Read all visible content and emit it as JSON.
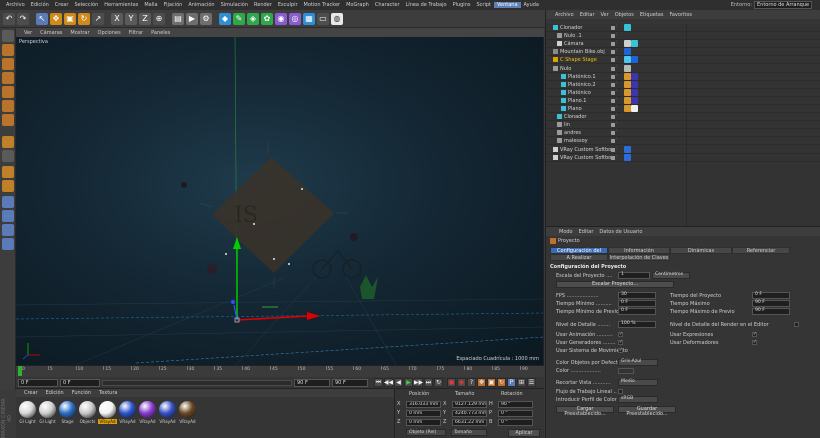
{
  "menubar": {
    "items": [
      "Archivo",
      "Edición",
      "Crear",
      "Selección",
      "Herramientas",
      "Malla",
      "Fijación",
      "Animación",
      "Simulación",
      "Render",
      "Esculpir",
      "Motion Tracker",
      "MoGraph",
      "Character",
      "Línea de Trabajo",
      "Plugins",
      "Script",
      "Ventana",
      "Ayuda"
    ],
    "active_index": 17,
    "entorno_label": "Entorno:",
    "entorno_value": "Entorno de Arranque"
  },
  "viewport": {
    "menu": [
      "Ver",
      "Cámaras",
      "Mostrar",
      "Opciones",
      "Filtrar",
      "Paneles"
    ],
    "view_name": "Perspectiva",
    "grid_info": "Espaciado Cuadrícula : 1000 mm",
    "colors": {
      "bg_center": "#1f3b4c",
      "bg_edge": "#0b1820",
      "axis_y": "#00c000",
      "axis_x": "#e00000",
      "axis_z": "#3050ff"
    }
  },
  "timeline": {
    "ticks": [
      "0",
      "5",
      "10",
      "15",
      "20",
      "25",
      "30",
      "35",
      "40",
      "45",
      "50",
      "55",
      "60",
      "65",
      "70",
      "75",
      "80",
      "85",
      "90"
    ],
    "current_frame": "0 F",
    "start_frame": "0 F",
    "end_frame_a": "90 F",
    "end_frame_b": "90 F"
  },
  "materials": {
    "menu": [
      "Crear",
      "Edición",
      "Función",
      "Textura"
    ],
    "items": [
      {
        "name": "Gl Light",
        "color": "#d8d8d8"
      },
      {
        "name": "Gl Light",
        "color": "#cfcfcf"
      },
      {
        "name": "Stage",
        "color": "#2a6fc9"
      },
      {
        "name": "Objects",
        "color": "#c8c8c8"
      },
      {
        "name": "VRayAd",
        "color": "#f3f3f3",
        "selected": true
      },
      {
        "name": "VRayAd",
        "color": "#2a55d0"
      },
      {
        "name": "VRayAd",
        "color": "#8a3bd0"
      },
      {
        "name": "VRayAd",
        "color": "#3550c8"
      },
      {
        "name": "VRayAd",
        "color": "#6a4a25"
      }
    ]
  },
  "coordinates": {
    "headers": [
      "Posición",
      "Tamaño",
      "Rotación"
    ],
    "rows": [
      {
        "axis": "X",
        "pos": "316.033 mm",
        "size_axis": "X",
        "size": "9127.129 mm",
        "rot_axis": "H",
        "rot": "90 °"
      },
      {
        "axis": "Y",
        "pos": "0 mm",
        "size_axis": "Y",
        "size": "4240.773 mm",
        "rot_axis": "P",
        "rot": "0 °"
      },
      {
        "axis": "Z",
        "pos": "0 mm",
        "size_axis": "Z",
        "size": "6631.22 mm",
        "rot_axis": "B",
        "rot": "0 °"
      }
    ],
    "mode": "Objeto (Rel)",
    "size_mode": "Tamaño",
    "apply": "Aplicar"
  },
  "object_manager": {
    "tabs": [
      "Archivo",
      "Editar",
      "Ver",
      "Objetos",
      "Etiquetas",
      "Favoritos"
    ],
    "rows": [
      {
        "name": "Clonador",
        "indent": 0,
        "icon": "#39c1d8",
        "tags": [
          "#39c1d8"
        ]
      },
      {
        "name": "Nulo .1",
        "indent": 1,
        "icon": "#9a9a9a",
        "tags": []
      },
      {
        "name": "Cámara",
        "indent": 1,
        "icon": "#d0d0d0",
        "tags": [
          "#d0d0d0",
          "#39c1d8"
        ]
      },
      {
        "name": "Mountain Bike.obj",
        "indent": 0,
        "icon": "#8a8a8a",
        "tags": [
          "#1c64d8"
        ]
      },
      {
        "name": "C Shape Stage",
        "indent": 0,
        "icon": "#e0a100",
        "tags": [
          "#4dc6f0",
          "#1c64d8"
        ],
        "selected": true
      },
      {
        "name": "Nulo",
        "indent": 0,
        "icon": "#9a9a9a",
        "tags": [
          "#b9b9b9"
        ]
      },
      {
        "name": "Platónico.1",
        "indent": 2,
        "icon": "#39c1d8",
        "tags": [
          "#d79a2a",
          "#3d35b0"
        ]
      },
      {
        "name": "Platónico.2",
        "indent": 2,
        "icon": "#39c1d8",
        "tags": [
          "#d79a2a",
          "#3d35b0"
        ]
      },
      {
        "name": "Platónico",
        "indent": 2,
        "icon": "#39c1d8",
        "tags": [
          "#d79a2a",
          "#3d35b0"
        ]
      },
      {
        "name": "Plano.1",
        "indent": 2,
        "icon": "#39c1d8",
        "tags": [
          "#d79a2a",
          "#3d35b0"
        ]
      },
      {
        "name": "Plano",
        "indent": 2,
        "icon": "#39c1d8",
        "tags": [
          "#d79a2a",
          "#f0f0f0"
        ]
      },
      {
        "name": "Clonador",
        "indent": 1,
        "icon": "#39c1d8",
        "tags": []
      },
      {
        "name": "lin",
        "indent": 1,
        "icon": "#9a9a9a",
        "tags": []
      },
      {
        "name": "andres",
        "indent": 1,
        "icon": "#9a9a9a",
        "tags": []
      },
      {
        "name": "malessoy",
        "indent": 1,
        "icon": "#9a9a9a",
        "tags": []
      },
      {
        "name": "VRay Custom Softbox",
        "indent": 0,
        "icon": "#d0d0d0",
        "tags": [
          "#2b6cd8"
        ]
      },
      {
        "name": "VRay Custom Softbox",
        "indent": 0,
        "icon": "#d0d0d0",
        "tags": [
          "#2b6cd8"
        ]
      }
    ]
  },
  "attributes": {
    "tabs": [
      "Modo",
      "Editar",
      "Datos de Usuario"
    ],
    "object_label": "Proyecto",
    "ptabs_row1": [
      "Configuración del Proyecto",
      "Información",
      "Dinámicas",
      "Referenciar"
    ],
    "ptabs_row2": [
      "A Realizar",
      "Interpolación de Claves"
    ],
    "section_title": "Configuración del Proyecto",
    "scale_label": "Escala del Proyecto ....",
    "scale_value": "1",
    "scale_unit": "Centímetros",
    "scale_button": "Escalar Proyecto...",
    "fps_label": "FPS ....................",
    "fps_value": "30",
    "tmin_label": "Tiempo Mínimo ..........",
    "tmin_value": "0 F",
    "tminprev_label": "Tiempo Mínimo de Previo",
    "tminprev_value": "0 F",
    "tproj_label": "Tiempo del Proyecto",
    "tproj_value": "0 F",
    "tmax_label": "Tiempo Máximo",
    "tmax_value": "90 F",
    "tmaxprev_label": "Tiempo Máximo de Previo",
    "tmaxprev_value": "90 F",
    "lod_label": "Nivel de Detalle ........",
    "lod_value": "100 %",
    "lodeditor_label": "Nivel de Detalle del Render en el Editor",
    "chk_anim": "Usar Animación ..........",
    "chk_expr": "Usar Expresiones",
    "chk_gen": "Usar Generadores ........",
    "chk_def": "Usar Deformadores",
    "chk_motion": "Usar Sistema de Movimiento",
    "colorobj_label": "Color Objetos por Defecto",
    "colorobj_value": "Gris-Azul",
    "color_label": "Color ...................",
    "clip_label": "Recortar Vista ...........",
    "clip_value": "Medio",
    "linear_label": "Flujo de Trabajo Lineal ..",
    "profile_label": "Introducir Perfil de Color",
    "profile_value": "sRGB",
    "btn_load": "Cargar Preestablecido...",
    "btn_save": "Guardar Preestablecido..."
  },
  "watermark": "MAXON CINEMA 4D"
}
